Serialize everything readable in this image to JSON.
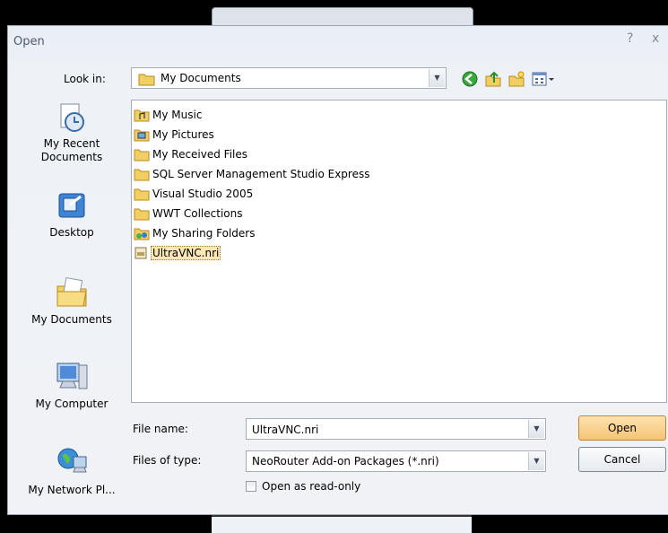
{
  "dialog": {
    "title": "Open",
    "help_glyph": "?",
    "close_glyph": "x"
  },
  "look_in": {
    "label": "Look in:",
    "value": "My Documents",
    "toolbar_icons": [
      "back-icon",
      "up-folder-icon",
      "new-folder-icon",
      "views-menu-icon"
    ]
  },
  "places": [
    {
      "label": "My Recent Documents",
      "icon": "recent-documents-icon"
    },
    {
      "label": "Desktop",
      "icon": "desktop-icon"
    },
    {
      "label": "My Documents",
      "icon": "my-documents-icon"
    },
    {
      "label": "My Computer",
      "icon": "my-computer-icon"
    },
    {
      "label": "My Network Pl...",
      "icon": "network-places-icon"
    }
  ],
  "files": [
    {
      "name": "My Music",
      "icon": "music-folder-icon"
    },
    {
      "name": "My Pictures",
      "icon": "pictures-folder-icon"
    },
    {
      "name": "My Received Files",
      "icon": "folder-icon"
    },
    {
      "name": "SQL Server Management Studio Express",
      "icon": "folder-icon"
    },
    {
      "name": "Visual Studio 2005",
      "icon": "folder-icon"
    },
    {
      "name": "WWT Collections",
      "icon": "folder-icon"
    },
    {
      "name": "My Sharing Folders",
      "icon": "sharing-folder-icon"
    },
    {
      "name": "UltraVNC.nri",
      "icon": "nri-file-icon",
      "selected": true
    }
  ],
  "file_name": {
    "label": "File name:",
    "value": "UltraVNC.nri"
  },
  "file_type": {
    "label": "Files of type:",
    "value": "NeoRouter Add-on Packages (*.nri)"
  },
  "buttons": {
    "open": "Open",
    "cancel": "Cancel"
  },
  "read_only": {
    "label": "Open as read-only",
    "checked": false
  },
  "colors": {
    "accent_button": "#f6c374",
    "selection": "#fde7b5",
    "folder": "#f2cf63"
  }
}
